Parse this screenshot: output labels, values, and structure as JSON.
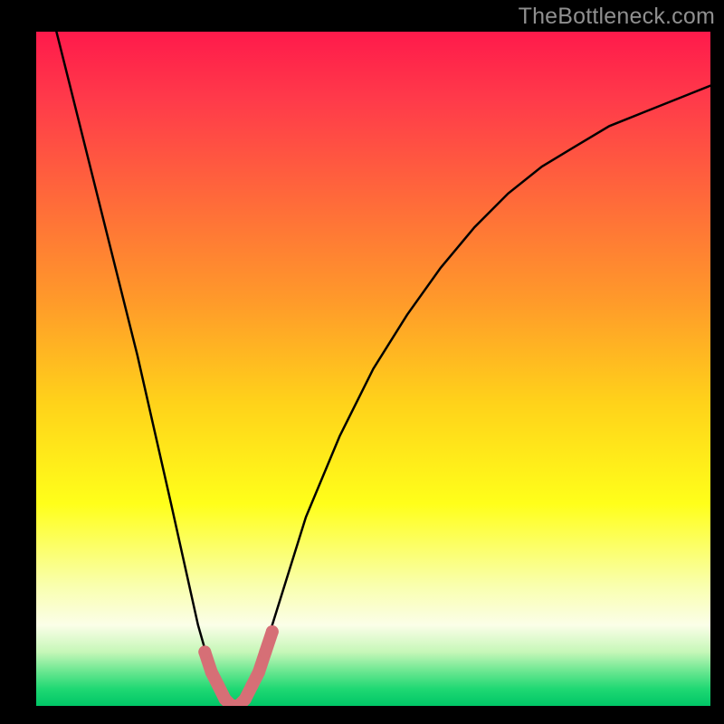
{
  "watermark": "TheBottleneck.com",
  "colors": {
    "bg": "#000000",
    "curve": "#000000",
    "highlight": "#d66f76",
    "gradient_stops": [
      {
        "offset": 0.0,
        "color": "#ff1a4b"
      },
      {
        "offset": 0.1,
        "color": "#ff3a4a"
      },
      {
        "offset": 0.25,
        "color": "#ff6a3a"
      },
      {
        "offset": 0.4,
        "color": "#ff9a2a"
      },
      {
        "offset": 0.55,
        "color": "#ffd21a"
      },
      {
        "offset": 0.7,
        "color": "#ffff1a"
      },
      {
        "offset": 0.82,
        "color": "#f9ffac"
      },
      {
        "offset": 0.88,
        "color": "#fbfee8"
      },
      {
        "offset": 0.92,
        "color": "#c6f7b8"
      },
      {
        "offset": 0.95,
        "color": "#66e68f"
      },
      {
        "offset": 0.975,
        "color": "#1fd873"
      },
      {
        "offset": 1.0,
        "color": "#00c666"
      }
    ]
  },
  "chart_data": {
    "type": "line",
    "title": "",
    "xlabel": "",
    "ylabel": "",
    "xlim": [
      0,
      100
    ],
    "ylim": [
      0,
      100
    ],
    "series": [
      {
        "name": "bottleneck-curve",
        "x": [
          0,
          5,
          10,
          15,
          20,
          24,
          26,
          28,
          29,
          30,
          31,
          33,
          35,
          40,
          45,
          50,
          55,
          60,
          65,
          70,
          75,
          80,
          85,
          90,
          95,
          100
        ],
        "y": [
          112,
          92,
          72,
          52,
          30,
          12,
          5,
          1,
          0,
          0,
          1,
          5,
          12,
          28,
          40,
          50,
          58,
          65,
          71,
          76,
          80,
          83,
          86,
          88,
          90,
          92
        ]
      }
    ],
    "highlight": {
      "points_x": [
        25,
        26,
        27,
        28,
        29,
        30,
        31,
        32,
        33,
        34,
        35
      ],
      "points_y": [
        8,
        5,
        3,
        1,
        0,
        0,
        1,
        3,
        5,
        8,
        11
      ]
    }
  }
}
